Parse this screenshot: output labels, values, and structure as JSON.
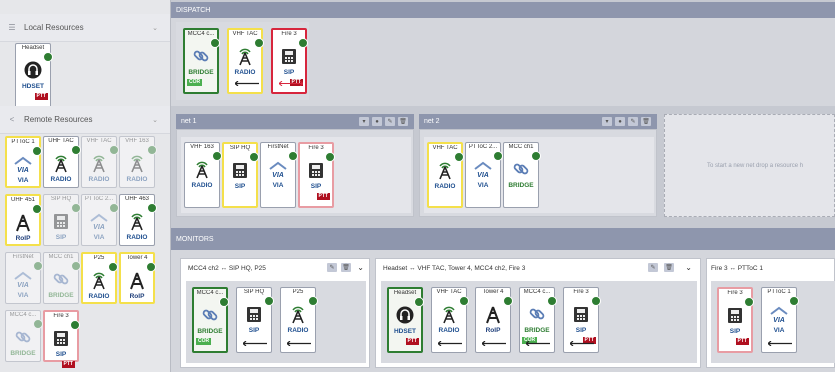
{
  "sidebar": {
    "local_title": "Local Resources",
    "remote_title": "Remote Resources",
    "local_tiles": [
      {
        "label": "Headset",
        "type": "HDSET",
        "badge": "PTT"
      }
    ],
    "remote_tiles": [
      {
        "label": "PTToC 1",
        "type": "VIA",
        "style": "y"
      },
      {
        "label": "UHF TAC",
        "type": "RADIO",
        "style": ""
      },
      {
        "label": "VHF TAC",
        "type": "RADIO",
        "style": "dim"
      },
      {
        "label": "VHF 163",
        "type": "RADIO",
        "style": "dim"
      },
      {
        "label": "UHF 451",
        "type": "RoIP",
        "style": "y"
      },
      {
        "label": "SIP HQ",
        "type": "SIP",
        "style": "dim"
      },
      {
        "label": "PTToC 2...",
        "type": "VIA",
        "style": "dim"
      },
      {
        "label": "UHF 463",
        "type": "RADIO",
        "style": ""
      },
      {
        "label": "FirstNet",
        "type": "VIA",
        "style": "dim"
      },
      {
        "label": "MCC ch1",
        "type": "BRIDGE",
        "style": "dim"
      },
      {
        "label": "P25",
        "type": "RADIO",
        "style": "y"
      },
      {
        "label": "Tower 4",
        "type": "RoIP",
        "style": "y"
      },
      {
        "label": "MCC4 c...",
        "type": "BRIDGE",
        "style": "dim"
      },
      {
        "label": "Fire 3",
        "type": "SIP",
        "style": "rl",
        "badge": "PTT"
      }
    ]
  },
  "dispatch": {
    "title": "DISPATCH",
    "tiles": [
      {
        "label": "MCC4 c...",
        "type": "BRIDGE",
        "style": "g",
        "badge": "COR"
      },
      {
        "label": "VHF TAC",
        "type": "RADIO",
        "style": "y",
        "arrow": "left"
      },
      {
        "label": "Fire 3",
        "type": "SIP",
        "style": "r",
        "badge": "PTT",
        "arrow": "both"
      }
    ]
  },
  "nets": [
    {
      "title": "net 1",
      "tiles": [
        {
          "label": "VHF 163",
          "type": "RADIO",
          "style": ""
        },
        {
          "label": "SIP HQ",
          "type": "SIP",
          "style": "y"
        },
        {
          "label": "FirstNet",
          "type": "VIA",
          "style": ""
        },
        {
          "label": "Fire 3",
          "type": "SIP",
          "style": "rl",
          "badge": "PTT"
        }
      ]
    },
    {
      "title": "net 2",
      "tiles": [
        {
          "label": "VHF TAC",
          "type": "RADIO",
          "style": "y"
        },
        {
          "label": "PTToC 2...",
          "type": "VIA",
          "style": ""
        },
        {
          "label": "MCC ch1",
          "type": "BRIDGE",
          "style": ""
        }
      ]
    }
  ],
  "dropzone_text": "To start a new net drop a resource h",
  "monitors": {
    "title": "MONITORS",
    "groups": [
      {
        "title": "MCC4 ch2 ↔ SIP HQ, P25",
        "tiles": [
          {
            "label": "MCC4 c...",
            "type": "BRIDGE",
            "style": "g",
            "badge": "COR"
          },
          {
            "label": "SIP HQ",
            "type": "SIP",
            "style": "",
            "arrow": "left"
          },
          {
            "label": "P25",
            "type": "RADIO",
            "style": "",
            "arrow": "left"
          }
        ]
      },
      {
        "title": "Headset ↔ VHF TAC, Tower 4, MCC4 ch2, Fire 3",
        "tiles": [
          {
            "label": "Headset",
            "type": "HDSET",
            "style": "g",
            "badge": "PTT"
          },
          {
            "label": "VHF TAC",
            "type": "RADIO",
            "style": "",
            "arrow": "left"
          },
          {
            "label": "Tower 4",
            "type": "RoIP",
            "style": "",
            "arrow": "left"
          },
          {
            "label": "MCC4 c...",
            "type": "BRIDGE",
            "style": "",
            "badge": "COR",
            "arrow": "left"
          },
          {
            "label": "Fire 3",
            "type": "SIP",
            "style": "",
            "badge": "PTT",
            "arrow": "left"
          }
        ]
      },
      {
        "title": "Fire 3 ↔ PTToC 1",
        "tiles": [
          {
            "label": "Fire 3",
            "type": "SIP",
            "style": "rl",
            "badge": "PTT"
          },
          {
            "label": "PTToC 1",
            "type": "VIA",
            "style": "",
            "arrow": "left"
          }
        ]
      }
    ]
  },
  "colors": {
    "accent": "#8e96ad",
    "radio": "#1f4f8f",
    "green": "#2e7d32",
    "red": "#d7263d",
    "yellow": "#f4e04b"
  }
}
